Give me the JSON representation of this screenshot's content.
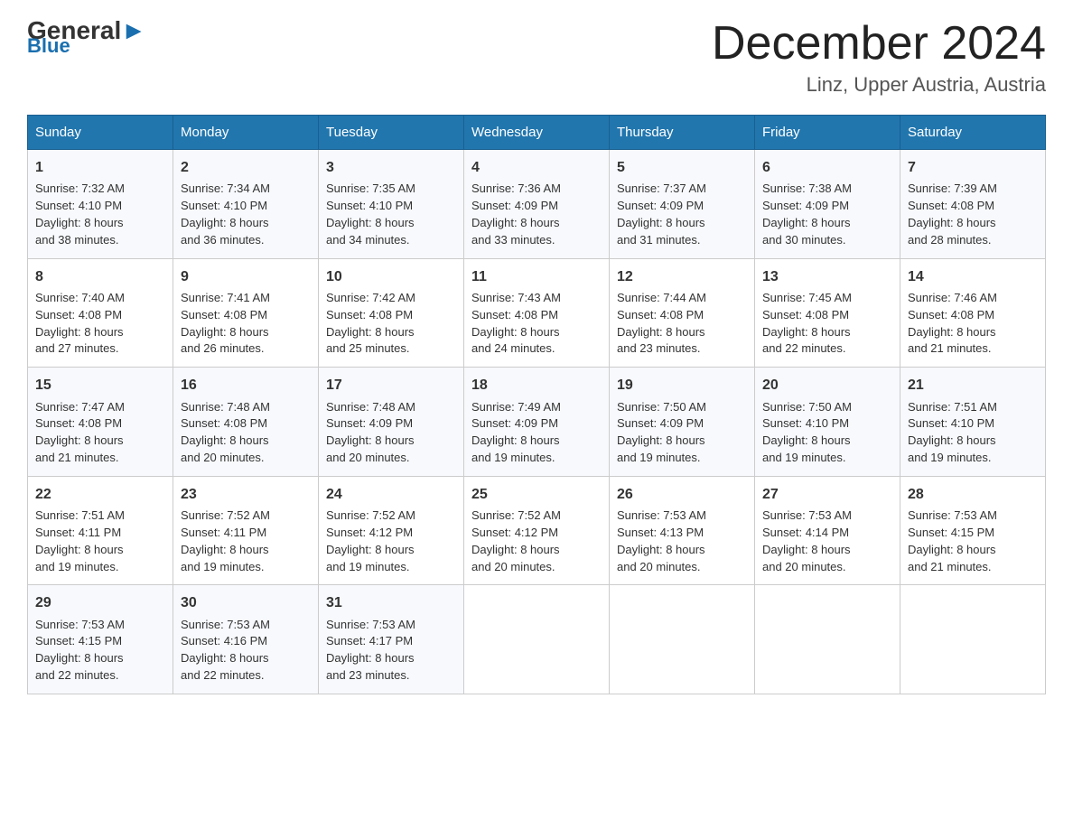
{
  "logo": {
    "general": "General",
    "blue": "Blue"
  },
  "title": "December 2024",
  "location": "Linz, Upper Austria, Austria",
  "weekdays": [
    "Sunday",
    "Monday",
    "Tuesday",
    "Wednesday",
    "Thursday",
    "Friday",
    "Saturday"
  ],
  "weeks": [
    [
      {
        "day": "1",
        "sunrise": "7:32 AM",
        "sunset": "4:10 PM",
        "daylight": "8 hours and 38 minutes."
      },
      {
        "day": "2",
        "sunrise": "7:34 AM",
        "sunset": "4:10 PM",
        "daylight": "8 hours and 36 minutes."
      },
      {
        "day": "3",
        "sunrise": "7:35 AM",
        "sunset": "4:10 PM",
        "daylight": "8 hours and 34 minutes."
      },
      {
        "day": "4",
        "sunrise": "7:36 AM",
        "sunset": "4:09 PM",
        "daylight": "8 hours and 33 minutes."
      },
      {
        "day": "5",
        "sunrise": "7:37 AM",
        "sunset": "4:09 PM",
        "daylight": "8 hours and 31 minutes."
      },
      {
        "day": "6",
        "sunrise": "7:38 AM",
        "sunset": "4:09 PM",
        "daylight": "8 hours and 30 minutes."
      },
      {
        "day": "7",
        "sunrise": "7:39 AM",
        "sunset": "4:08 PM",
        "daylight": "8 hours and 28 minutes."
      }
    ],
    [
      {
        "day": "8",
        "sunrise": "7:40 AM",
        "sunset": "4:08 PM",
        "daylight": "8 hours and 27 minutes."
      },
      {
        "day": "9",
        "sunrise": "7:41 AM",
        "sunset": "4:08 PM",
        "daylight": "8 hours and 26 minutes."
      },
      {
        "day": "10",
        "sunrise": "7:42 AM",
        "sunset": "4:08 PM",
        "daylight": "8 hours and 25 minutes."
      },
      {
        "day": "11",
        "sunrise": "7:43 AM",
        "sunset": "4:08 PM",
        "daylight": "8 hours and 24 minutes."
      },
      {
        "day": "12",
        "sunrise": "7:44 AM",
        "sunset": "4:08 PM",
        "daylight": "8 hours and 23 minutes."
      },
      {
        "day": "13",
        "sunrise": "7:45 AM",
        "sunset": "4:08 PM",
        "daylight": "8 hours and 22 minutes."
      },
      {
        "day": "14",
        "sunrise": "7:46 AM",
        "sunset": "4:08 PM",
        "daylight": "8 hours and 21 minutes."
      }
    ],
    [
      {
        "day": "15",
        "sunrise": "7:47 AM",
        "sunset": "4:08 PM",
        "daylight": "8 hours and 21 minutes."
      },
      {
        "day": "16",
        "sunrise": "7:48 AM",
        "sunset": "4:08 PM",
        "daylight": "8 hours and 20 minutes."
      },
      {
        "day": "17",
        "sunrise": "7:48 AM",
        "sunset": "4:09 PM",
        "daylight": "8 hours and 20 minutes."
      },
      {
        "day": "18",
        "sunrise": "7:49 AM",
        "sunset": "4:09 PM",
        "daylight": "8 hours and 19 minutes."
      },
      {
        "day": "19",
        "sunrise": "7:50 AM",
        "sunset": "4:09 PM",
        "daylight": "8 hours and 19 minutes."
      },
      {
        "day": "20",
        "sunrise": "7:50 AM",
        "sunset": "4:10 PM",
        "daylight": "8 hours and 19 minutes."
      },
      {
        "day": "21",
        "sunrise": "7:51 AM",
        "sunset": "4:10 PM",
        "daylight": "8 hours and 19 minutes."
      }
    ],
    [
      {
        "day": "22",
        "sunrise": "7:51 AM",
        "sunset": "4:11 PM",
        "daylight": "8 hours and 19 minutes."
      },
      {
        "day": "23",
        "sunrise": "7:52 AM",
        "sunset": "4:11 PM",
        "daylight": "8 hours and 19 minutes."
      },
      {
        "day": "24",
        "sunrise": "7:52 AM",
        "sunset": "4:12 PM",
        "daylight": "8 hours and 19 minutes."
      },
      {
        "day": "25",
        "sunrise": "7:52 AM",
        "sunset": "4:12 PM",
        "daylight": "8 hours and 20 minutes."
      },
      {
        "day": "26",
        "sunrise": "7:53 AM",
        "sunset": "4:13 PM",
        "daylight": "8 hours and 20 minutes."
      },
      {
        "day": "27",
        "sunrise": "7:53 AM",
        "sunset": "4:14 PM",
        "daylight": "8 hours and 20 minutes."
      },
      {
        "day": "28",
        "sunrise": "7:53 AM",
        "sunset": "4:15 PM",
        "daylight": "8 hours and 21 minutes."
      }
    ],
    [
      {
        "day": "29",
        "sunrise": "7:53 AM",
        "sunset": "4:15 PM",
        "daylight": "8 hours and 22 minutes."
      },
      {
        "day": "30",
        "sunrise": "7:53 AM",
        "sunset": "4:16 PM",
        "daylight": "8 hours and 22 minutes."
      },
      {
        "day": "31",
        "sunrise": "7:53 AM",
        "sunset": "4:17 PM",
        "daylight": "8 hours and 23 minutes."
      },
      null,
      null,
      null,
      null
    ]
  ],
  "labels": {
    "sunrise": "Sunrise:",
    "sunset": "Sunset:",
    "daylight": "Daylight:"
  }
}
